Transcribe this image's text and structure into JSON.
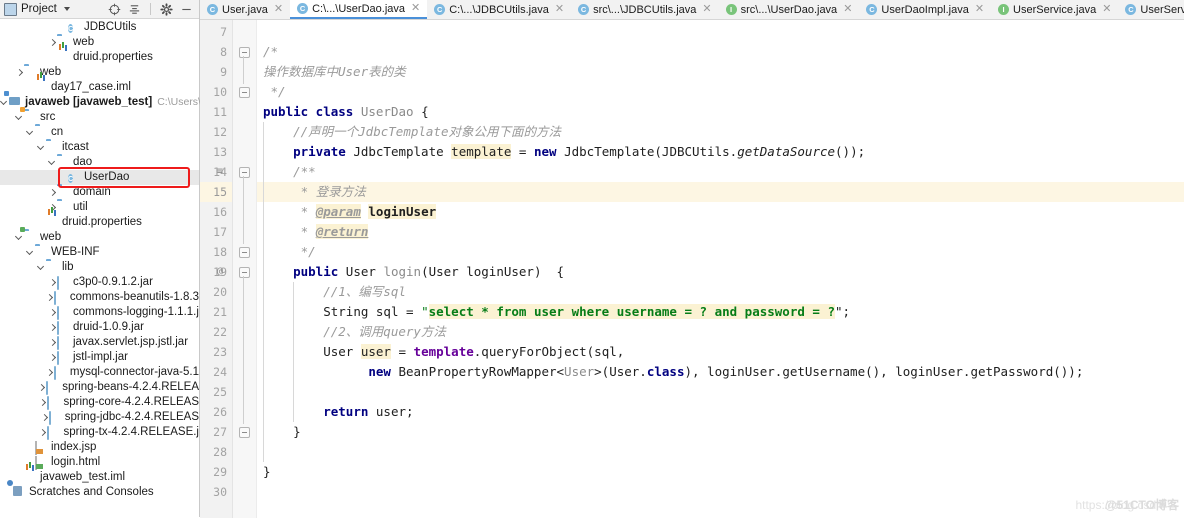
{
  "window": {
    "project_panel_title": "Project"
  },
  "toolbar": {
    "icons": [
      {
        "name": "locate-icon",
        "glyph": "target"
      },
      {
        "name": "collapse-all-icon",
        "glyph": "collapse"
      },
      {
        "name": "settings-gear-icon",
        "glyph": "gear"
      },
      {
        "name": "hide-panel-icon",
        "glyph": "minus"
      }
    ]
  },
  "tree": {
    "items": [
      {
        "indent": 5,
        "arrow": "none",
        "icon": "class-icon",
        "glyph": "C",
        "label": "JDBCUtils",
        "bold": false,
        "path": ""
      },
      {
        "indent": 4,
        "arrow": "right",
        "icon": "folder-icon",
        "label": "web",
        "bold": false,
        "path": ""
      },
      {
        "indent": 4,
        "arrow": "none",
        "icon": "properties-icon",
        "label": "druid.properties",
        "bold": false,
        "path": ""
      },
      {
        "indent": 1,
        "arrow": "right",
        "icon": "folder-icon",
        "label": "web",
        "bold": false,
        "path": ""
      },
      {
        "indent": 2,
        "arrow": "none",
        "icon": "iml-icon",
        "label": "day17_case.iml",
        "bold": false,
        "path": ""
      },
      {
        "indent": 0,
        "arrow": "down",
        "icon": "module-icon",
        "label": "javaweb [javaweb_test]",
        "bold": true,
        "path": "C:\\Users\\CRJ\\"
      },
      {
        "indent": 1,
        "arrow": "down",
        "icon": "source-folder-icon",
        "label": "src",
        "bold": false,
        "path": ""
      },
      {
        "indent": 2,
        "arrow": "down",
        "icon": "folder-icon",
        "label": "cn",
        "bold": false,
        "path": ""
      },
      {
        "indent": 3,
        "arrow": "down",
        "icon": "folder-icon",
        "label": "itcast",
        "bold": false,
        "path": ""
      },
      {
        "indent": 4,
        "arrow": "down",
        "icon": "folder-icon",
        "label": "dao",
        "bold": false,
        "path": ""
      },
      {
        "indent": 5,
        "arrow": "none",
        "icon": "class-icon",
        "glyph": "C",
        "label": "UserDao",
        "bold": false,
        "path": "",
        "selected": true,
        "highlighted": true
      },
      {
        "indent": 4,
        "arrow": "right",
        "icon": "folder-icon",
        "label": "domain",
        "bold": false,
        "path": ""
      },
      {
        "indent": 4,
        "arrow": "right",
        "icon": "folder-icon",
        "label": "util",
        "bold": false,
        "path": ""
      },
      {
        "indent": 3,
        "arrow": "none",
        "icon": "properties-icon",
        "label": "druid.properties",
        "bold": false,
        "path": ""
      },
      {
        "indent": 1,
        "arrow": "down",
        "icon": "web-folder-icon",
        "label": "web",
        "bold": false,
        "path": ""
      },
      {
        "indent": 2,
        "arrow": "down",
        "icon": "folder-icon",
        "label": "WEB-INF",
        "bold": false,
        "path": ""
      },
      {
        "indent": 3,
        "arrow": "down",
        "icon": "folder-icon",
        "label": "lib",
        "bold": false,
        "path": ""
      },
      {
        "indent": 4,
        "arrow": "right",
        "icon": "jar-icon",
        "label": "c3p0-0.9.1.2.jar",
        "bold": false,
        "path": ""
      },
      {
        "indent": 4,
        "arrow": "right",
        "icon": "jar-icon",
        "label": "commons-beanutils-1.8.3",
        "bold": false,
        "path": ""
      },
      {
        "indent": 4,
        "arrow": "right",
        "icon": "jar-icon",
        "label": "commons-logging-1.1.1.j",
        "bold": false,
        "path": ""
      },
      {
        "indent": 4,
        "arrow": "right",
        "icon": "jar-icon",
        "label": "druid-1.0.9.jar",
        "bold": false,
        "path": ""
      },
      {
        "indent": 4,
        "arrow": "right",
        "icon": "jar-icon",
        "label": "javax.servlet.jsp.jstl.jar",
        "bold": false,
        "path": ""
      },
      {
        "indent": 4,
        "arrow": "right",
        "icon": "jar-icon",
        "label": "jstl-impl.jar",
        "bold": false,
        "path": ""
      },
      {
        "indent": 4,
        "arrow": "right",
        "icon": "jar-icon",
        "label": "mysql-connector-java-5.1",
        "bold": false,
        "path": ""
      },
      {
        "indent": 4,
        "arrow": "right",
        "icon": "jar-icon",
        "label": "spring-beans-4.2.4.RELEA",
        "bold": false,
        "path": ""
      },
      {
        "indent": 4,
        "arrow": "right",
        "icon": "jar-icon",
        "label": "spring-core-4.2.4.RELEAS",
        "bold": false,
        "path": ""
      },
      {
        "indent": 4,
        "arrow": "right",
        "icon": "jar-icon",
        "label": "spring-jdbc-4.2.4.RELEAS",
        "bold": false,
        "path": ""
      },
      {
        "indent": 4,
        "arrow": "right",
        "icon": "jar-icon",
        "label": "spring-tx-4.2.4.RELEASE.j",
        "bold": false,
        "path": ""
      },
      {
        "indent": 2,
        "arrow": "none",
        "icon": "jsp-icon",
        "label": "index.jsp",
        "bold": false,
        "path": ""
      },
      {
        "indent": 2,
        "arrow": "none",
        "icon": "html-icon",
        "label": "login.html",
        "bold": false,
        "path": ""
      },
      {
        "indent": 1,
        "arrow": "none",
        "icon": "iml-icon",
        "label": "javaweb_test.iml",
        "bold": false,
        "path": ""
      },
      {
        "indent": 0,
        "arrow": "none",
        "icon": "scratches-icon",
        "label": "Scratches and Consoles",
        "bold": false,
        "path": ""
      }
    ]
  },
  "tabs": [
    {
      "label": "User.java",
      "icon": "class-icon",
      "kind": "c",
      "active": false
    },
    {
      "label": "C:\\...\\UserDao.java",
      "icon": "class-icon",
      "kind": "c",
      "active": true
    },
    {
      "label": "C:\\...\\JDBCUtils.java",
      "icon": "class-icon",
      "kind": "c",
      "active": false
    },
    {
      "label": "src\\...\\JDBCUtils.java",
      "icon": "class-icon",
      "kind": "c",
      "active": false
    },
    {
      "label": "src\\...\\UserDao.java",
      "icon": "interface-icon",
      "kind": "i",
      "active": false
    },
    {
      "label": "UserDaoImpl.java",
      "icon": "class-icon",
      "kind": "c",
      "active": false
    },
    {
      "label": "UserService.java",
      "icon": "interface-icon",
      "kind": "i",
      "active": false
    },
    {
      "label": "UserServiceImpl.java",
      "icon": "class-icon",
      "kind": "c",
      "active": false
    }
  ],
  "editor": {
    "first_line_number": 7,
    "last_line_number": 30,
    "highlighted_line": 15,
    "gutter_marks": [
      {
        "line": 14,
        "glyph": "list-icon"
      },
      {
        "line": 19,
        "glyph": "@"
      }
    ],
    "lines": [
      {
        "n": 7,
        "text": ""
      },
      {
        "n": 8,
        "text": "/*"
      },
      {
        "n": 9,
        "text": "操作数据库中User表的类"
      },
      {
        "n": 10,
        "text": " */"
      },
      {
        "n": 11,
        "text": "public class UserDao {"
      },
      {
        "n": 12,
        "text": "    //声明一个JdbcTemplate对象公用下面的方法"
      },
      {
        "n": 13,
        "text": "    private JdbcTemplate template = new JdbcTemplate(JDBCUtils.getDataSource());"
      },
      {
        "n": 14,
        "text": "    /**"
      },
      {
        "n": 15,
        "text": "     * 登录方法"
      },
      {
        "n": 16,
        "text": "     * @param loginUser"
      },
      {
        "n": 17,
        "text": "     * @return"
      },
      {
        "n": 18,
        "text": "     */"
      },
      {
        "n": 19,
        "text": "    public User login(User loginUser)  {"
      },
      {
        "n": 20,
        "text": "        //1、编写sql"
      },
      {
        "n": 21,
        "text": "        String sql = \"select * from user where username = ? and password = ?\";"
      },
      {
        "n": 22,
        "text": "        //2、调用query方法"
      },
      {
        "n": 23,
        "text": "        User user = template.queryForObject(sql,"
      },
      {
        "n": 24,
        "text": "              new BeanPropertyRowMapper<User>(User.class), loginUser.getUsername(), loginUser.getPassword());"
      },
      {
        "n": 25,
        "text": ""
      },
      {
        "n": 26,
        "text": "        return user;"
      },
      {
        "n": 27,
        "text": "    }"
      },
      {
        "n": 28,
        "text": ""
      },
      {
        "n": 29,
        "text": "}"
      },
      {
        "n": 30,
        "text": ""
      }
    ]
  },
  "watermark": {
    "text_left": "https://blog.csdn",
    "text_right": "@51CTO博客"
  },
  "colors": {
    "keyword": "#000080",
    "string": "#067d17",
    "comment": "#9a9a9a",
    "highlight": "#fbf2d3",
    "annotation_box": "#ee1b1b",
    "tab_active_underline": "#4a90d9"
  }
}
